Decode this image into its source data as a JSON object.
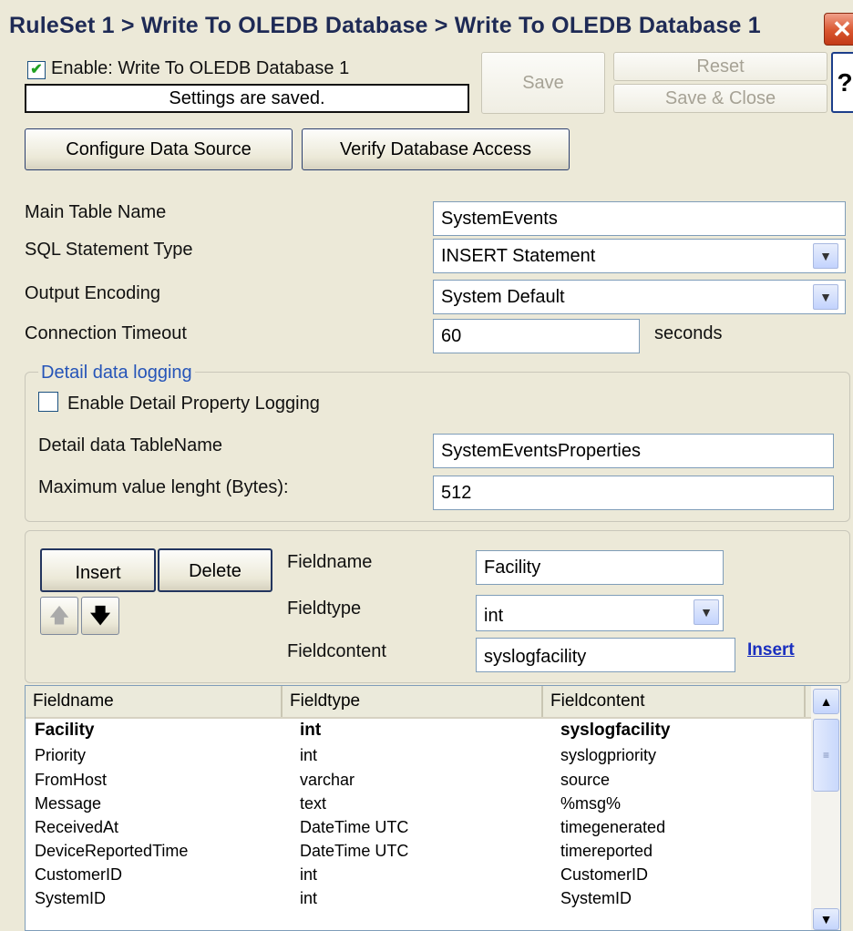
{
  "window": {
    "title": "RuleSet 1 > Write To OLEDB Database > Write To OLEDB Database 1",
    "close_glyph": "✕"
  },
  "status": {
    "enable_label": "Enable: Write To OLEDB Database 1",
    "enable_checked": true,
    "message": "Settings are saved."
  },
  "toolbar": {
    "save_label": "Save",
    "reset_label": "Reset",
    "save_close_label": "Save & Close",
    "help_label": "?"
  },
  "actions": {
    "configure_label": "Configure Data Source",
    "verify_label": "Verify Database Access"
  },
  "settings": {
    "main_table_label": "Main Table Name",
    "main_table_value": "SystemEvents",
    "sql_type_label": "SQL Statement Type",
    "sql_type_value": "INSERT Statement",
    "encoding_label": "Output Encoding",
    "encoding_value": "System Default",
    "timeout_label": "Connection Timeout",
    "timeout_value": "60",
    "timeout_unit": "seconds"
  },
  "detail": {
    "legend": "Detail data logging",
    "enable_label": "Enable Detail Property Logging",
    "enable_checked": false,
    "table_label": "Detail data TableName",
    "table_value": "SystemEventsProperties",
    "maxlen_label": "Maximum value lenght (Bytes):",
    "maxlen_value": "512"
  },
  "fields_editor": {
    "insert_label": "Insert",
    "delete_label": "Delete",
    "up_glyph": "🡅",
    "down_glyph": "🡇",
    "fieldname_label": "Fieldname",
    "fieldname_value": "Facility",
    "fieldtype_label": "Fieldtype",
    "fieldtype_value": "int",
    "fieldcontent_label": "Fieldcontent",
    "fieldcontent_value": "syslogfacility",
    "insert_link": "Insert"
  },
  "table": {
    "columns": [
      "Fieldname",
      "Fieldtype",
      "Fieldcontent"
    ],
    "rows": [
      [
        "Facility",
        "int",
        "syslogfacility"
      ],
      [
        "Priority",
        "int",
        "syslogpriority"
      ],
      [
        "FromHost",
        "varchar",
        "source"
      ],
      [
        "Message",
        "text",
        "%msg%"
      ],
      [
        "ReceivedAt",
        "DateTime UTC",
        "timegenerated"
      ],
      [
        "DeviceReportedTime",
        "DateTime UTC",
        "timereported"
      ],
      [
        "CustomerID",
        "int",
        "CustomerID"
      ],
      [
        "SystemID",
        "int",
        "SystemID"
      ]
    ],
    "selected_row": 0
  }
}
